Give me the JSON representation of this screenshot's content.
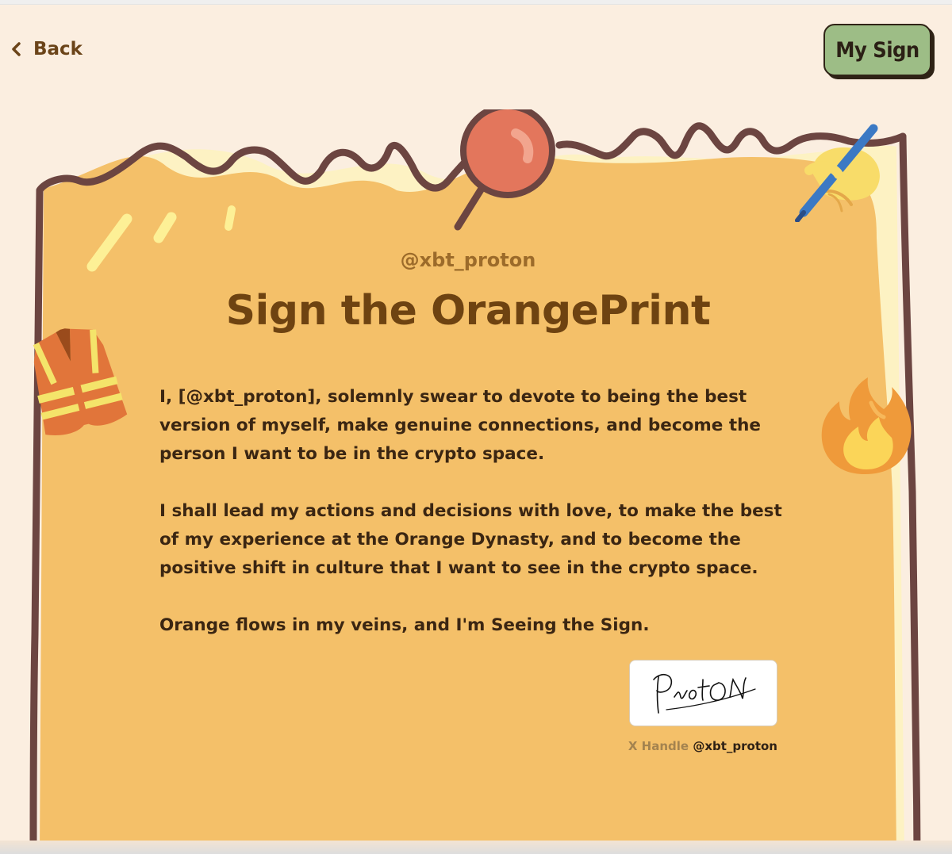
{
  "nav": {
    "back_label": "Back",
    "my_sign_label": "My Sign"
  },
  "document": {
    "handle_heading": "@xbt_proton",
    "title": "Sign the OrangePrint",
    "paragraphs": [
      "I, [@xbt_proton], solemnly swear to devote to being the best version of myself, make genuine connections, and become the person I want to be in the crypto space.",
      "I shall lead my actions and decisions with love, to make the best of my experience at the Orange Dynasty, and to become the positive shift in culture that I want to see in the crypto space.",
      "Orange flows in my veins, and I'm Seeing the Sign."
    ],
    "signature": {
      "handwritten": "ProtON",
      "x_handle_label": "X Handle",
      "x_handle_value": "@xbt_proton"
    }
  },
  "colors": {
    "background": "#fbeee0",
    "paper": "#f4c069",
    "paper_edge": "#fdf2c3",
    "outline": "#6c4541",
    "title": "#6e4311",
    "my_sign_button": "#9dbd86"
  },
  "icons": [
    "chevron-left-icon",
    "pushpin-icon",
    "quill-pen-icon",
    "safety-vest-icon",
    "fire-icon"
  ]
}
